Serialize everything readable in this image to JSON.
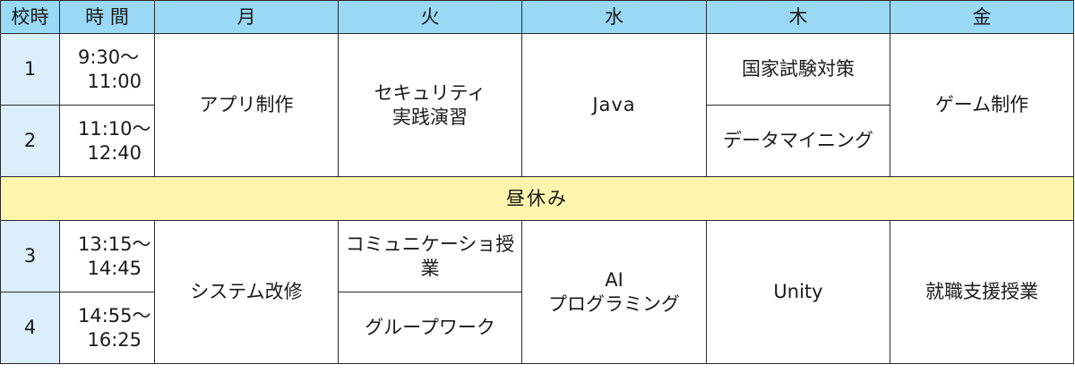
{
  "header": {
    "school_period": "校時",
    "time": "時 間",
    "days": [
      "月",
      "火",
      "水",
      "木",
      "金"
    ]
  },
  "periods": [
    {
      "num": "1",
      "start": "9:30〜",
      "end": "11:00"
    },
    {
      "num": "2",
      "start": "11:10〜",
      "end": "12:40"
    },
    {
      "num": "3",
      "start": "13:15〜",
      "end": "14:45"
    },
    {
      "num": "4",
      "start": "14:55〜",
      "end": "16:25"
    }
  ],
  "morning": {
    "mon": "アプリ制作",
    "tue_line1": "セキュリティ",
    "tue_line2": "実践演習",
    "wed": "Java",
    "thu_p1": "国家試験対策",
    "thu_p2": "データマイニング",
    "fri": "ゲーム制作"
  },
  "lunch": "昼休み",
  "afternoon": {
    "mon": "システム改修",
    "tue_p3": "コミュニケーショ授業",
    "tue_p4": "グループワーク",
    "wed_line1": "AI",
    "wed_line2": "プログラミング",
    "thu": "Unity",
    "fri": "就職支援授業"
  }
}
